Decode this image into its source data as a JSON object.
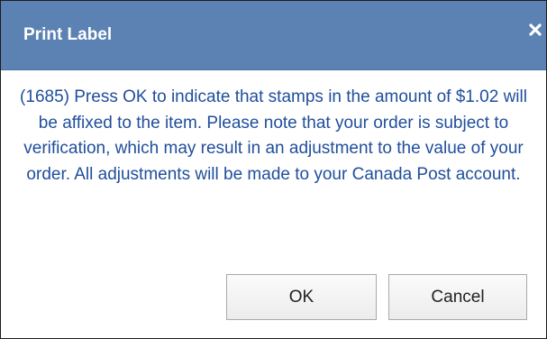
{
  "dialog": {
    "title": "Print Label",
    "close_icon": "close-x-icon",
    "message": "(1685) Press OK to indicate that stamps in the amount of $1.02 will be affixed to the item. Please note that your order is subject to verification, which may result in an adjustment to the value of your order. All adjustments will be made to your Canada Post account.",
    "ok_label": "OK",
    "cancel_label": "Cancel"
  },
  "colors": {
    "titlebar": "#5b82b3",
    "message_text": "#1f4e9c",
    "title_text": "#ffffff"
  }
}
